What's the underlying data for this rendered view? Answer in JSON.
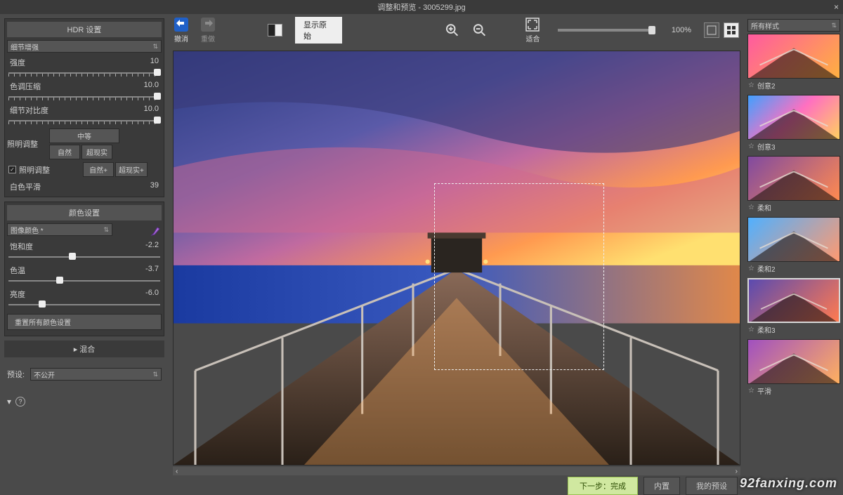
{
  "window": {
    "title": "调整和预览 - 3005299.jpg"
  },
  "hdr": {
    "panel_title": "HDR 设置",
    "mode": "细节增强",
    "sliders": {
      "strength": {
        "label": "强度",
        "value": "10"
      },
      "compress": {
        "label": "色调压缩",
        "value": "10.0"
      },
      "detail": {
        "label": "细节对比度",
        "value": "10.0"
      }
    },
    "lighting": {
      "label": "照明调整",
      "buttons": {
        "medium": "中等",
        "natural": "自然",
        "surreal": "超现实",
        "natural_plus": "自然+",
        "surreal_plus": "超现实+"
      },
      "check_label": "照明调整"
    },
    "white_smooth": {
      "label": "白色平滑",
      "value": "39"
    }
  },
  "color": {
    "panel_title": "颜色设置",
    "mode": "图像颜色 *",
    "sliders": {
      "sat": {
        "label": "饱和度",
        "value": "-2.2"
      },
      "temp": {
        "label": "色温",
        "value": "-3.7"
      },
      "bri": {
        "label": "亮度",
        "value": "-6.0"
      }
    },
    "reset": "重置所有颜色设置"
  },
  "blend": {
    "title": "混合"
  },
  "preset": {
    "label": "预设:",
    "value": "不公开"
  },
  "toolbar": {
    "undo": "撤消",
    "redo": "重做",
    "show_original": "显示原始",
    "fit": "适合",
    "zoom_percent": "100%"
  },
  "right": {
    "dropdown": "所有样式",
    "thumbs": [
      {
        "label": "创意2"
      },
      {
        "label": "创意3"
      },
      {
        "label": "柔和"
      },
      {
        "label": "柔和2"
      },
      {
        "label": "柔和3"
      },
      {
        "label": "平滑"
      }
    ]
  },
  "bottom": {
    "next": "下一步：完成",
    "internal": "内置",
    "my_presets": "我的预设"
  },
  "watermark": "92fanxing.com"
}
